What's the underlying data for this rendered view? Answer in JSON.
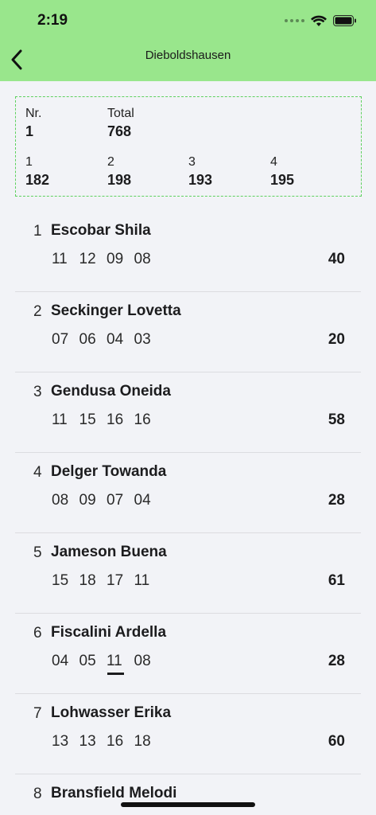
{
  "status": {
    "time": "2:19"
  },
  "nav": {
    "title": "Dieboldshausen"
  },
  "summary": {
    "nr_label": "Nr.",
    "nr_value": "1",
    "total_label": "Total",
    "total_value": "768",
    "rounds": [
      {
        "label": "1",
        "value": "182"
      },
      {
        "label": "2",
        "value": "198"
      },
      {
        "label": "3",
        "value": "193"
      },
      {
        "label": "4",
        "value": "195"
      }
    ]
  },
  "players": [
    {
      "num": "1",
      "name": "Escobar Shila",
      "scores": [
        "11",
        "12",
        "09",
        "08"
      ],
      "total": "40"
    },
    {
      "num": "2",
      "name": "Seckinger Lovetta",
      "scores": [
        "07",
        "06",
        "04",
        "03"
      ],
      "total": "20"
    },
    {
      "num": "3",
      "name": "Gendusa Oneida",
      "scores": [
        "11",
        "15",
        "16",
        "16"
      ],
      "total": "58"
    },
    {
      "num": "4",
      "name": "Delger Towanda",
      "scores": [
        "08",
        "09",
        "07",
        "04"
      ],
      "total": "28"
    },
    {
      "num": "5",
      "name": "Jameson Buena",
      "scores": [
        "15",
        "18",
        "17",
        "11"
      ],
      "total": "61"
    },
    {
      "num": "6",
      "name": "Fiscalini Ardella",
      "scores": [
        "04",
        "05",
        "11",
        "08"
      ],
      "total": "28"
    },
    {
      "num": "7",
      "name": "Lohwasser Erika",
      "scores": [
        "13",
        "13",
        "16",
        "18"
      ],
      "total": "60"
    },
    {
      "num": "8",
      "name": "Bransfield Melodi",
      "scores": [],
      "total": ""
    }
  ],
  "selected_score": {
    "player_index": 5,
    "score_index": 2
  }
}
